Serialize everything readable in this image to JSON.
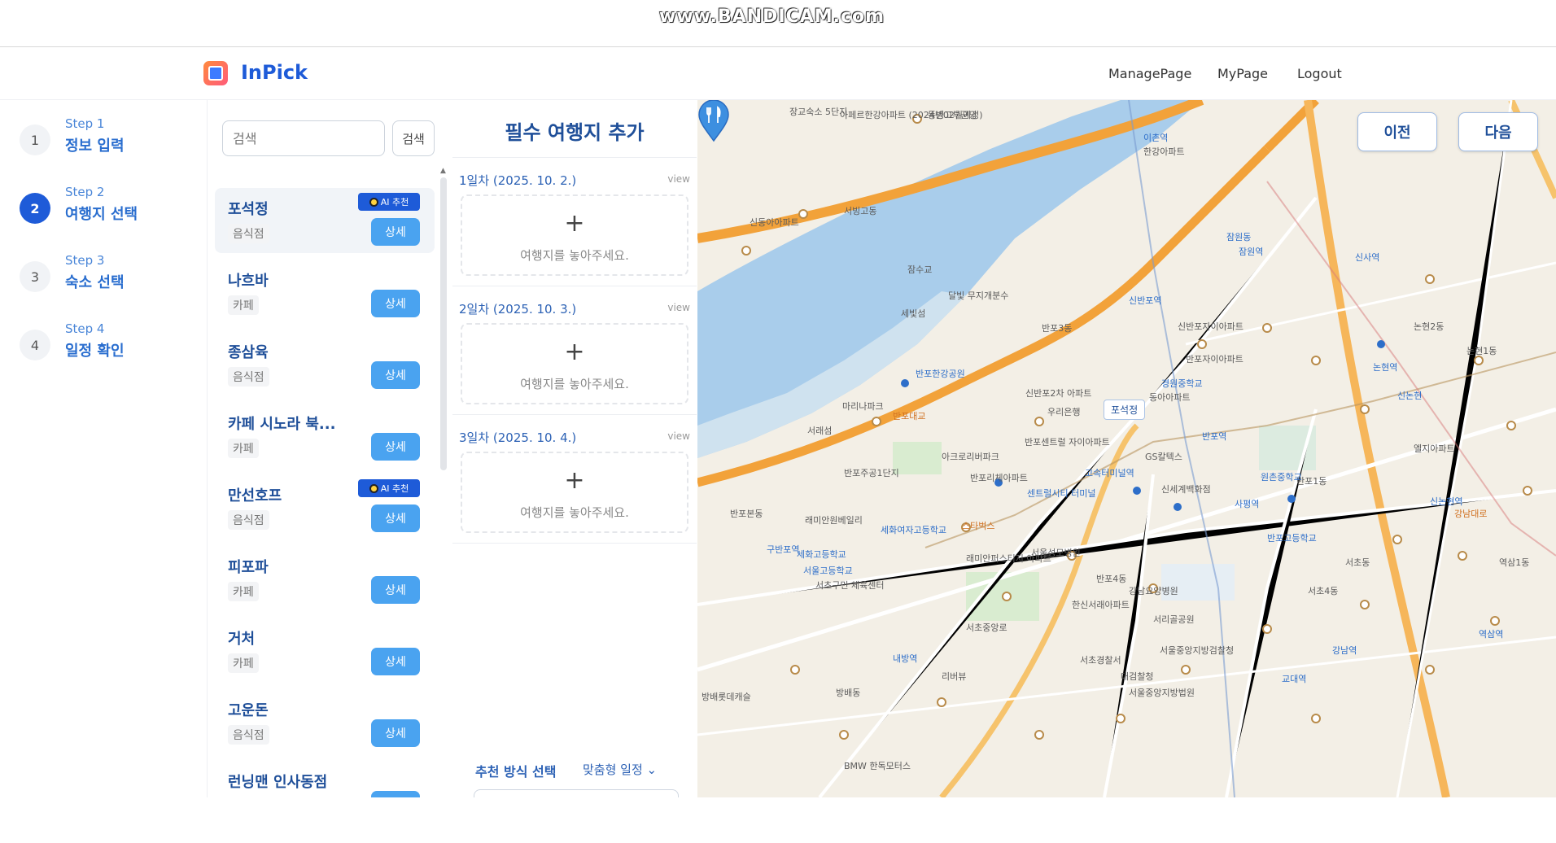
{
  "watermark": "www.BANDICAM.com",
  "header": {
    "app_name": "InPick",
    "nav": [
      "ManagePage",
      "MyPage",
      "Logout"
    ]
  },
  "steps": [
    {
      "number": "1",
      "sub": "Step 1",
      "title": "정보 입력",
      "active": false
    },
    {
      "number": "2",
      "sub": "Step 2",
      "title": "여행지 선택",
      "active": true
    },
    {
      "number": "3",
      "sub": "Step 3",
      "title": "숙소 선택",
      "active": false
    },
    {
      "number": "4",
      "sub": "Step 4",
      "title": "일정 확인",
      "active": false
    }
  ],
  "search": {
    "placeholder": "검색",
    "button_label": "검색"
  },
  "places": [
    {
      "name": "포석정",
      "category": "음식점",
      "ai": true,
      "selected": true
    },
    {
      "name": "나흐바",
      "category": "카페",
      "ai": false
    },
    {
      "name": "종삼육",
      "category": "음식점",
      "ai": false
    },
    {
      "name": "카페 시노라 북...",
      "category": "카페",
      "ai": false
    },
    {
      "name": "만선호프",
      "category": "음식점",
      "ai": true
    },
    {
      "name": "피포파",
      "category": "카페",
      "ai": false
    },
    {
      "name": "거처",
      "category": "카페",
      "ai": false
    },
    {
      "name": "고운돈",
      "category": "음식점",
      "ai": false
    },
    {
      "name": "런닝맨 인사동점",
      "category": "",
      "ai": false
    }
  ],
  "place_detail_label": "상세",
  "ai_badge_label": "AI 추천",
  "days_panel": {
    "title": "필수 여행지 추가",
    "view_label": "view",
    "plus": "+",
    "drop_hint": "여행지를 놓아주세요.",
    "days": [
      "1일차 (2025. 10. 2.)",
      "2일차 (2025. 10. 3.)",
      "3일차 (2025. 10. 4.)"
    ],
    "recommend_label": "추천 방식 선택",
    "recommend_value": "맞춤형 일정 ⌄"
  },
  "map": {
    "prev_label": "이전",
    "next_label": "다음",
    "marker_label": "포석정",
    "labels": [
      "장교숙소 5단지",
      "아페르한강아파트 (2024년02월예정)",
      "동빙고부군당",
      "한강아파트",
      "이촌역",
      "서빙고동",
      "신동아아파트",
      "반포3동",
      "반포한강공원",
      "신반포2차 아파트",
      "반포역",
      "고속터미널역",
      "GS칼텍스",
      "신반포역",
      "잠원동",
      "잠원역",
      "신사역",
      "논현역",
      "신논현역",
      "사평역",
      "반포1동",
      "구반포역",
      "세화고등학교",
      "반포4동",
      "서울성모병원",
      "강남요양병원",
      "서초4동",
      "서초동",
      "교대역",
      "내방역",
      "방배동",
      "서울중앙지방법원",
      "서울중앙지방검찰청",
      "서초경찰서",
      "대검찰청",
      "서리골공원",
      "우리은행",
      "반포센트럴 자이아파트",
      "신반포자이아파트",
      "래미안퍼스티지 아파트",
      "반포리체아파트",
      "반포자이아파트",
      "경원중학교",
      "원촌중학교",
      "논현2동",
      "논현1동",
      "역삼역",
      "강남역",
      "마리나파크",
      "서래섬",
      "반포본동",
      "반포주공1단지",
      "아크로리버파크",
      "신세계백화점",
      "센트럴시티 터미널",
      "래미안원베일리",
      "세화여자고등학교",
      "서초구민 체육센터",
      "스타벅스",
      "서울고등학교",
      "반포고등학교",
      "반포대교",
      "잠수교",
      "세빛섬",
      "달빛 무지개분수",
      "동아아파트",
      "한신서래아파트",
      "방배롯데캐슬",
      "서초중앙로",
      "BMW 한독모터스",
      "엘지아파트",
      "리버뷰",
      "강남대로",
      "신논현",
      "역삼1동"
    ]
  }
}
